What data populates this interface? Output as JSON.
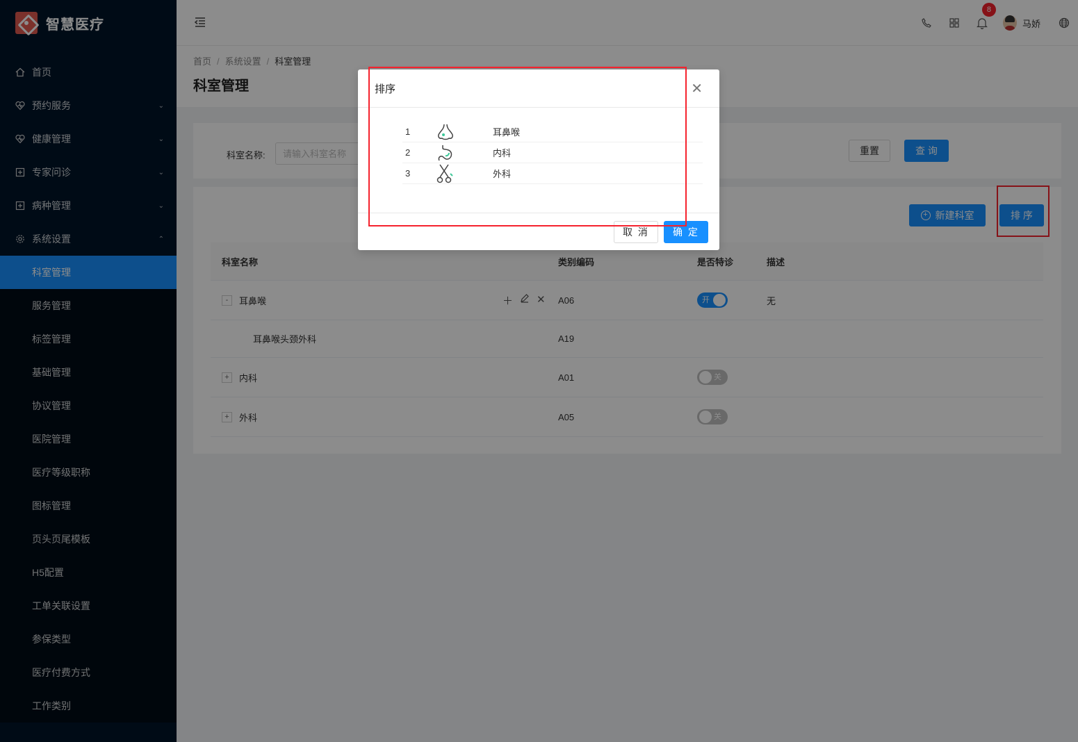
{
  "app": {
    "name": "智慧医疗"
  },
  "sidebar": {
    "items": [
      {
        "label": "首页",
        "icon": "home-icon"
      },
      {
        "label": "预约服务",
        "icon": "heart-icon"
      },
      {
        "label": "健康管理",
        "icon": "heart-icon"
      },
      {
        "label": "专家问诊",
        "icon": "plus-square-icon"
      },
      {
        "label": "病种管理",
        "icon": "plus-square-icon"
      },
      {
        "label": "系统设置",
        "icon": "gear-icon"
      }
    ],
    "sub_items": [
      "科室管理",
      "服务管理",
      "标签管理",
      "基础管理",
      "协议管理",
      "医院管理",
      "医疗等级职称",
      "图标管理",
      "页头页尾模板",
      "H5配置",
      "工单关联设置",
      "参保类型",
      "医疗付费方式",
      "工作类别"
    ],
    "active": "科室管理"
  },
  "header": {
    "notification_count": "8",
    "user_name": "马娇"
  },
  "breadcrumb": [
    "首页",
    "系统设置",
    "科室管理"
  ],
  "page_title": "科室管理",
  "search": {
    "label": "科室名称:",
    "placeholder": "请输入科室名称",
    "reset": "重置",
    "query": "查 询"
  },
  "actions": {
    "new": "新建科室",
    "sort": "排 序"
  },
  "table": {
    "headers": [
      "科室名称",
      "类别编码",
      "是否特诊",
      "描述"
    ],
    "rows": [
      {
        "name": "耳鼻喉",
        "expander": "-",
        "code": "A06",
        "special": "开",
        "desc": "无"
      },
      {
        "name": "耳鼻喉头颈外科",
        "code": "A19"
      },
      {
        "name": "内科",
        "expander": "+",
        "code": "A01",
        "special": "关"
      },
      {
        "name": "外科",
        "expander": "+",
        "code": "A05",
        "special": "关"
      }
    ]
  },
  "modal": {
    "title": "排序",
    "items": [
      {
        "num": "1",
        "icon": "nose-icon",
        "name": "耳鼻喉"
      },
      {
        "num": "2",
        "icon": "stomach-icon",
        "name": "内科"
      },
      {
        "num": "3",
        "icon": "scissors-icon",
        "name": "外科"
      }
    ],
    "cancel": "取 消",
    "ok": "确 定"
  },
  "colors": {
    "primary": "#1890ff",
    "sidebar": "#001529",
    "highlight": "#f5222d",
    "icon_accent": "#3ec99a"
  }
}
